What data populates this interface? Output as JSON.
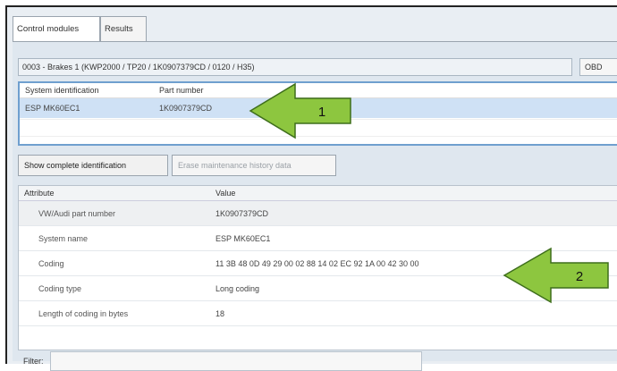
{
  "tabs": [
    {
      "label": "Control modules"
    },
    {
      "label": "Results"
    }
  ],
  "module_header": {
    "title": "0003 - Brakes 1  (KWP2000 / TP20 / 1K0907379CD / 0120 / H35)",
    "button_label": "OBD"
  },
  "identification_table": {
    "headers": [
      "System identification",
      "Part number"
    ],
    "rows": [
      {
        "system_id": "ESP MK60EC1",
        "part_number": "1K0907379CD"
      }
    ]
  },
  "buttons": {
    "show_complete": "Show complete identification",
    "erase_history": "Erase maintenance history data"
  },
  "attribute_table": {
    "headers": [
      "Attribute",
      "Value"
    ],
    "rows": [
      {
        "attribute": "VW/Audi part number",
        "value": "1K0907379CD"
      },
      {
        "attribute": "System name",
        "value": "ESP MK60EC1"
      },
      {
        "attribute": "Coding",
        "value": "11 3B 48 0D 49 29 00 02 88 14 02 EC 92 1A 00 42 30 00"
      },
      {
        "attribute": "Coding type",
        "value": "Long coding"
      },
      {
        "attribute": "Length of coding in bytes",
        "value": "18"
      }
    ]
  },
  "filter": {
    "label": "Filter:",
    "value": ""
  },
  "callouts": [
    {
      "number": "1"
    },
    {
      "number": "2"
    }
  ],
  "colors": {
    "callout_fill": "#8dc63f",
    "callout_stroke": "#3e6e1c",
    "selection": "#cfe1f5"
  }
}
